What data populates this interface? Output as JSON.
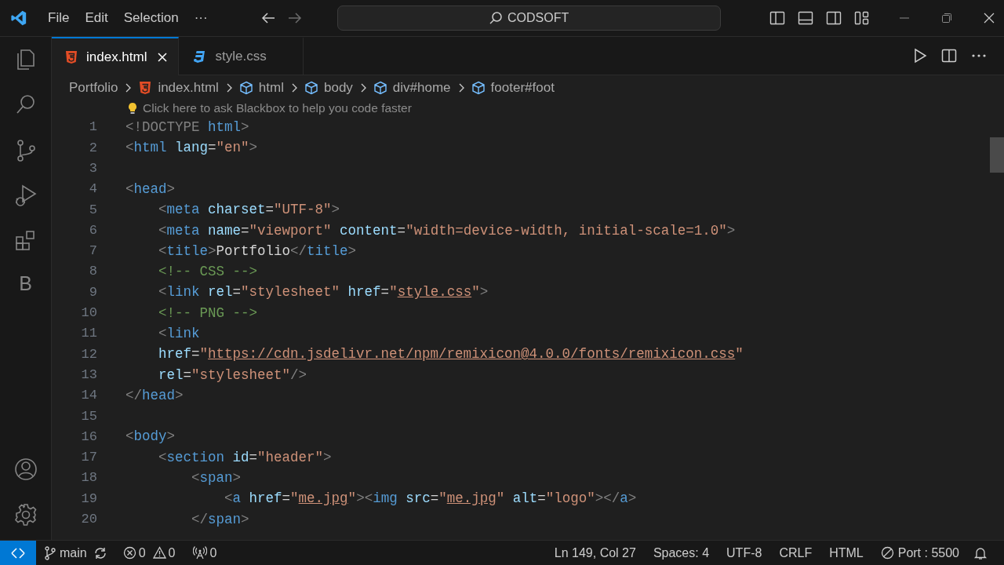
{
  "title_bar": {
    "menu": [
      "File",
      "Edit",
      "Selection",
      "···"
    ],
    "search": "CODSOFT"
  },
  "activity_bar": {
    "top": [
      {
        "kind": "explorer"
      },
      {
        "kind": "search"
      },
      {
        "kind": "source-control"
      },
      {
        "kind": "run"
      },
      {
        "kind": "extensions"
      },
      {
        "kind": "letter",
        "label": "B"
      }
    ],
    "bottom": [
      {
        "kind": "account"
      },
      {
        "kind": "settings"
      }
    ]
  },
  "tabs": [
    {
      "label": "index.html",
      "kind": "html",
      "selected": true
    },
    {
      "label": "style.css",
      "kind": "css",
      "selected": false
    }
  ],
  "breadcrumbs": [
    {
      "label": "Portfolio",
      "kind": "folder"
    },
    {
      "label": "index.html",
      "kind": "html"
    },
    {
      "label": "html",
      "kind": "element"
    },
    {
      "label": "body",
      "kind": "element"
    },
    {
      "label": "div#home",
      "kind": "element"
    },
    {
      "label": "footer#foot",
      "kind": "element"
    }
  ],
  "hint": "Click here to ask Blackbox to help you code faster",
  "lines": [
    {
      "n": "1",
      "tokens": [
        {
          "kind": "punctuation",
          "t": "<!DOCTYPE"
        },
        {
          "kind": "tag",
          "t": " html"
        },
        {
          "kind": "punctuation",
          "t": ">"
        }
      ]
    },
    {
      "n": "2",
      "tokens": [
        {
          "kind": "punctuation",
          "t": "<"
        },
        {
          "kind": "tag",
          "t": "html"
        },
        {
          "kind": "attribute",
          "t": " lang"
        },
        {
          "kind": "text",
          "t": "="
        },
        {
          "kind": "string",
          "t": "\"en\""
        },
        {
          "kind": "punctuation",
          "t": ">"
        }
      ]
    },
    {
      "n": "3"
    },
    {
      "n": "4",
      "tokens": [
        {
          "kind": "punctuation",
          "t": "<"
        },
        {
          "kind": "tag",
          "t": "head"
        },
        {
          "kind": "punctuation",
          "t": ">"
        }
      ]
    },
    {
      "n": "5",
      "tokens": [
        {
          "kind": "punctuation",
          "t": "    <"
        },
        {
          "kind": "tag",
          "t": "meta"
        },
        {
          "kind": "attribute",
          "t": " charset"
        },
        {
          "kind": "text",
          "t": "="
        },
        {
          "kind": "string",
          "t": "\"UTF-8\""
        },
        {
          "kind": "punctuation",
          "t": ">"
        }
      ]
    },
    {
      "n": "6",
      "tokens": [
        {
          "kind": "punctuation",
          "t": "    <"
        },
        {
          "kind": "tag",
          "t": "meta"
        },
        {
          "kind": "attribute",
          "t": " name"
        },
        {
          "kind": "text",
          "t": "="
        },
        {
          "kind": "string",
          "t": "\"viewport\""
        },
        {
          "kind": "attribute",
          "t": " content"
        },
        {
          "kind": "text",
          "t": "="
        },
        {
          "kind": "string",
          "t": "\"width=device-width, initial-scale=1.0\""
        },
        {
          "kind": "punctuation",
          "t": ">"
        }
      ]
    },
    {
      "n": "7",
      "tokens": [
        {
          "kind": "punctuation",
          "t": "    <"
        },
        {
          "kind": "tag",
          "t": "title"
        },
        {
          "kind": "punctuation",
          "t": ">"
        },
        {
          "kind": "text",
          "t": "Portfolio"
        },
        {
          "kind": "punctuation",
          "t": "</"
        },
        {
          "kind": "tag",
          "t": "title"
        },
        {
          "kind": "punctuation",
          "t": ">"
        }
      ]
    },
    {
      "n": "8",
      "tokens": [
        {
          "kind": "comment",
          "t": "    <!-- CSS -->"
        }
      ]
    },
    {
      "n": "9",
      "tokens": [
        {
          "kind": "punctuation",
          "t": "    <"
        },
        {
          "kind": "tag",
          "t": "link"
        },
        {
          "kind": "attribute",
          "t": " rel"
        },
        {
          "kind": "text",
          "t": "="
        },
        {
          "kind": "string",
          "t": "\"stylesheet\""
        },
        {
          "kind": "attribute",
          "t": " href"
        },
        {
          "kind": "text",
          "t": "="
        },
        {
          "kind": "string",
          "t": "\""
        },
        {
          "kind": "link",
          "t": "style.css"
        },
        {
          "kind": "string",
          "t": "\""
        },
        {
          "kind": "punctuation",
          "t": ">"
        }
      ]
    },
    {
      "n": "10",
      "tokens": [
        {
          "kind": "comment",
          "t": "    <!-- PNG -->"
        }
      ]
    },
    {
      "n": "11",
      "tokens": [
        {
          "kind": "punctuation",
          "t": "    <"
        },
        {
          "kind": "tag",
          "t": "link"
        }
      ]
    },
    {
      "n": "12",
      "tokens": [
        {
          "kind": "attribute",
          "t": "    href"
        },
        {
          "kind": "text",
          "t": "="
        },
        {
          "kind": "string",
          "t": "\""
        },
        {
          "kind": "link",
          "t": "https://cdn.jsdelivr.net/npm/remixicon@4.0.0/fonts/remixicon.css"
        },
        {
          "kind": "string",
          "t": "\""
        }
      ]
    },
    {
      "n": "13",
      "tokens": [
        {
          "kind": "attribute",
          "t": "    rel"
        },
        {
          "kind": "text",
          "t": "="
        },
        {
          "kind": "string",
          "t": "\"stylesheet\""
        },
        {
          "kind": "punctuation",
          "t": "/>"
        }
      ]
    },
    {
      "n": "14",
      "tokens": [
        {
          "kind": "punctuation",
          "t": "</"
        },
        {
          "kind": "tag",
          "t": "head"
        },
        {
          "kind": "punctuation",
          "t": ">"
        }
      ]
    },
    {
      "n": "15"
    },
    {
      "n": "16",
      "tokens": [
        {
          "kind": "punctuation",
          "t": "<"
        },
        {
          "kind": "tag",
          "t": "body"
        },
        {
          "kind": "punctuation",
          "t": ">"
        }
      ]
    },
    {
      "n": "17",
      "tokens": [
        {
          "kind": "punctuation",
          "t": "    <"
        },
        {
          "kind": "tag",
          "t": "section"
        },
        {
          "kind": "attribute",
          "t": " id"
        },
        {
          "kind": "text",
          "t": "="
        },
        {
          "kind": "string",
          "t": "\"header\""
        },
        {
          "kind": "punctuation",
          "t": ">"
        }
      ]
    },
    {
      "n": "18",
      "tokens": [
        {
          "kind": "punctuation",
          "t": "        <"
        },
        {
          "kind": "tag",
          "t": "span"
        },
        {
          "kind": "punctuation",
          "t": ">"
        }
      ]
    },
    {
      "n": "19",
      "tokens": [
        {
          "kind": "punctuation",
          "t": "            <"
        },
        {
          "kind": "tag",
          "t": "a"
        },
        {
          "kind": "attribute",
          "t": " href"
        },
        {
          "kind": "text",
          "t": "="
        },
        {
          "kind": "string",
          "t": "\""
        },
        {
          "kind": "link",
          "t": "me.jpg"
        },
        {
          "kind": "string",
          "t": "\""
        },
        {
          "kind": "punctuation",
          "t": "><"
        },
        {
          "kind": "tag",
          "t": "img"
        },
        {
          "kind": "attribute",
          "t": " src"
        },
        {
          "kind": "text",
          "t": "="
        },
        {
          "kind": "string",
          "t": "\""
        },
        {
          "kind": "link",
          "t": "me.jpg"
        },
        {
          "kind": "string",
          "t": "\""
        },
        {
          "kind": "attribute",
          "t": " alt"
        },
        {
          "kind": "text",
          "t": "="
        },
        {
          "kind": "string",
          "t": "\"logo\""
        },
        {
          "kind": "punctuation",
          "t": "></"
        },
        {
          "kind": "tag",
          "t": "a"
        },
        {
          "kind": "punctuation",
          "t": ">"
        }
      ]
    },
    {
      "n": "20",
      "tokens": [
        {
          "kind": "punctuation",
          "t": "        </"
        },
        {
          "kind": "tag",
          "t": "span"
        },
        {
          "kind": "punctuation",
          "t": ">"
        }
      ]
    }
  ],
  "status_bar": {
    "branch": "main",
    "errors": "0",
    "warnings": "0",
    "ports": "0",
    "right": [
      {
        "label": "Ln 149, Col 27",
        "kind": "text"
      },
      {
        "label": "Spaces: 4",
        "kind": "text"
      },
      {
        "label": "UTF-8",
        "kind": "text"
      },
      {
        "label": "CRLF",
        "kind": "text"
      },
      {
        "label": "HTML",
        "kind": "text"
      },
      {
        "label": "Port : 5500",
        "kind": "port"
      }
    ]
  }
}
